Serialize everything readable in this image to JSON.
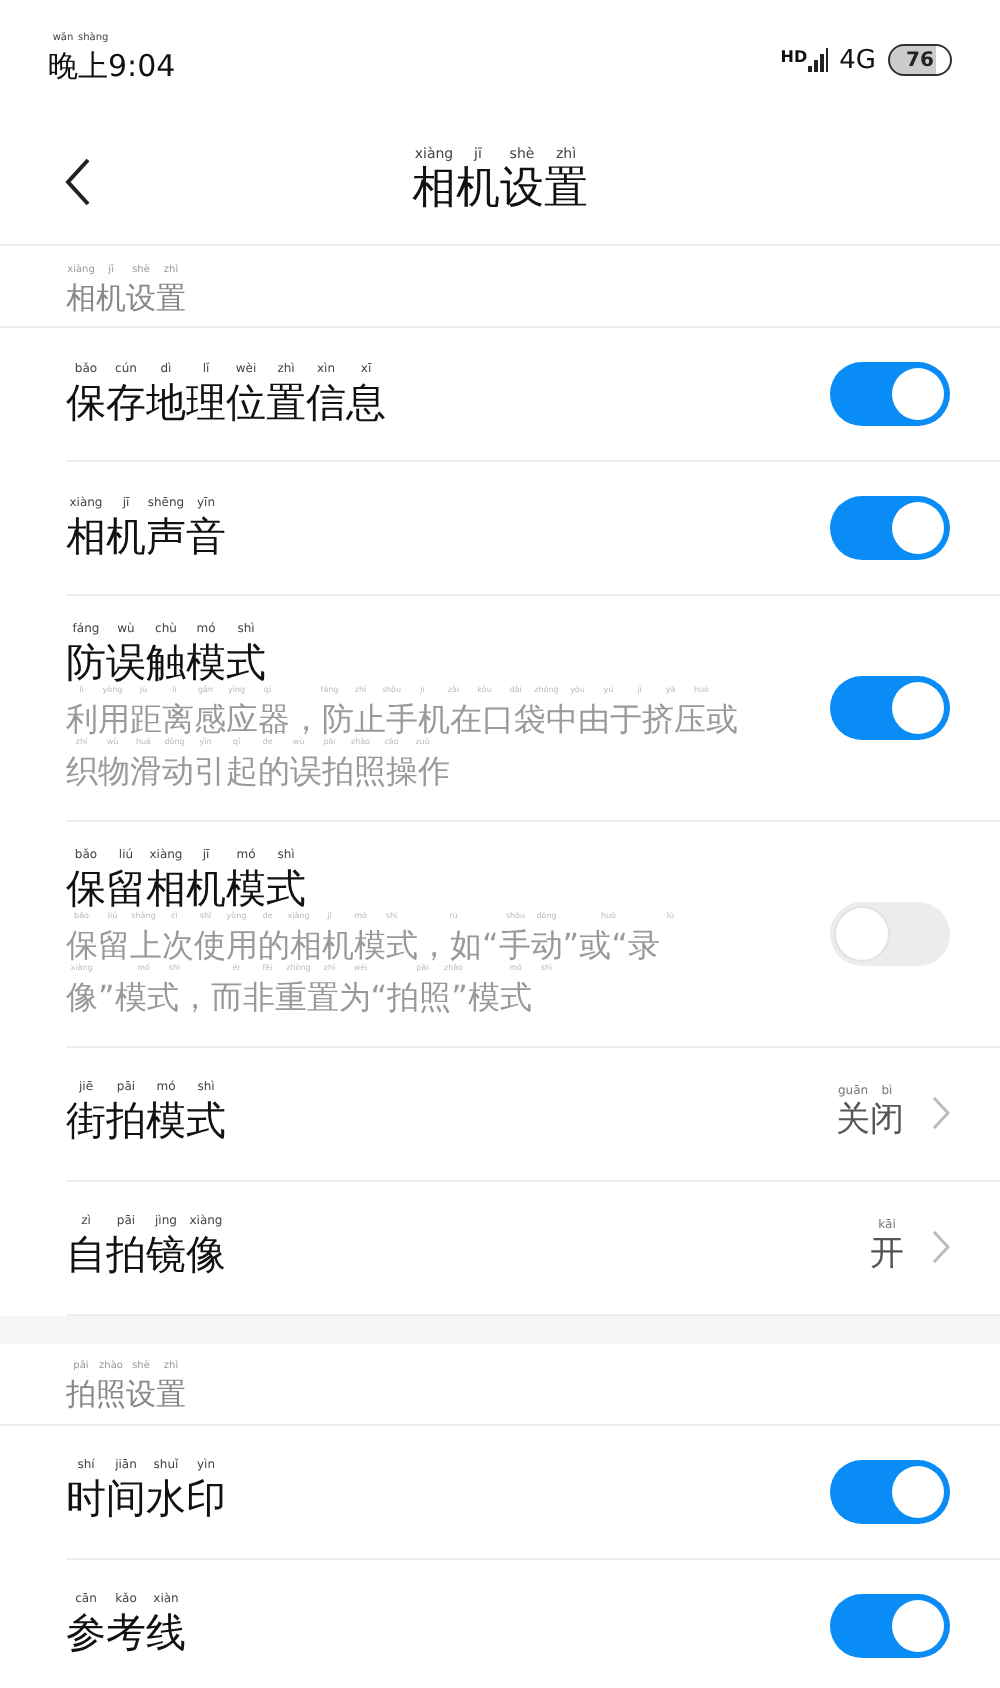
{
  "status_bar": {
    "time": {
      "text": "晚上9:04",
      "pinyin": "wǎn shàng"
    },
    "hd": "HD",
    "network": "4G",
    "battery": "76"
  },
  "header": {
    "title": {
      "text": "相机设置",
      "pinyin": "xiàng jī shè zhì"
    }
  },
  "sections": [
    {
      "title": {
        "text": "相机设置",
        "pinyin": "xiàng jī shè zhì"
      },
      "items": [
        {
          "kind": "toggle",
          "title": {
            "text": "保存地理位置信息",
            "pinyin": "bǎo cún dì lǐ wèi zhì xìn xī"
          },
          "on": true
        },
        {
          "kind": "toggle",
          "title": {
            "text": "相机声音",
            "pinyin": "xiàng jī shēng yīn"
          },
          "on": true
        },
        {
          "kind": "toggle",
          "title": {
            "text": "防误触模式",
            "pinyin": "fáng wù chù mó shì"
          },
          "description": [
            {
              "text": "利用距离感应器，防止手机在口袋中由于挤压或",
              "pinyin": "lì yòng jù lí gǎn yìng qì  fáng zhǐ shǒu jī zài kǒu dài zhōng yóu yú jǐ yā huò"
            },
            {
              "text": "织物滑动引起的误拍照操作",
              "pinyin": "zhī wù huá dòng yǐn qǐ de wù pāi zhào cāo zuò"
            }
          ],
          "on": true
        },
        {
          "kind": "toggle",
          "title": {
            "text": "保留相机模式",
            "pinyin": "bǎo liú xiàng jī mó shì"
          },
          "description": [
            {
              "text": "保留上次使用的相机模式，如“手动”或“录",
              "pinyin": "bǎo liú shàng cì shǐ yòng de xiàng jī mó shì  rú  shǒu dòng  huò  lù"
            },
            {
              "text": "像”模式，而非重置为“拍照”模式",
              "pinyin": "xiàng  mó shì  ér fēi zhòng zhì wéi  pāi zhào  mó shì"
            }
          ],
          "on": false
        },
        {
          "kind": "link",
          "title": {
            "text": "街拍模式",
            "pinyin": "jiē pāi mó shì"
          },
          "value": {
            "text": "关闭",
            "pinyin": "guān bì"
          }
        },
        {
          "kind": "link",
          "title": {
            "text": "自拍镜像",
            "pinyin": "zì pāi jìng xiàng"
          },
          "value": {
            "text": "开",
            "pinyin": "kāi"
          }
        }
      ]
    },
    {
      "title": {
        "text": "拍照设置",
        "pinyin": "pāi zhào shè zhì"
      },
      "items": [
        {
          "kind": "toggle",
          "title": {
            "text": "时间水印",
            "pinyin": "shí jiān shuǐ yìn"
          },
          "on": true
        },
        {
          "kind": "toggle",
          "title": {
            "text": "参考线",
            "pinyin": "cān kǎo xiàn"
          },
          "on": true
        }
      ]
    }
  ]
}
